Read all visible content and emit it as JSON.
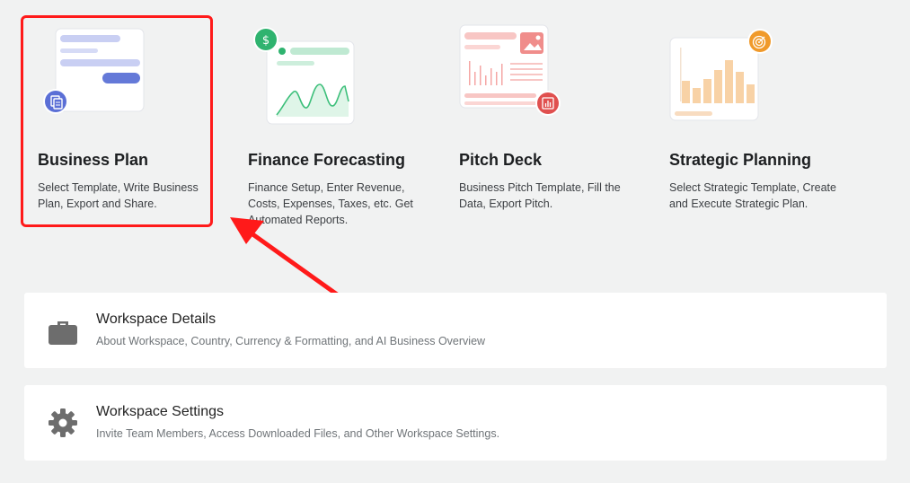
{
  "cards": [
    {
      "title": "Business Plan",
      "desc": "Select Template, Write Business Plan, Export and Share.",
      "icon": "document-icon",
      "badge_color": "#5b6fd6"
    },
    {
      "title": "Finance Forecasting",
      "desc": "Finance Setup, Enter Revenue, Costs, Expenses, Taxes, etc. Get Automated Reports.",
      "icon": "dollar-icon",
      "badge_color": "#2fb36f"
    },
    {
      "title": "Pitch Deck",
      "desc": "Business Pitch Template, Fill the Data, Export Pitch.",
      "icon": "bar-chart-icon",
      "badge_color": "#e0504f"
    },
    {
      "title": "Strategic Planning",
      "desc": "Select Strategic Template, Create and Execute Strategic Plan.",
      "icon": "target-icon",
      "badge_color": "#f09a2b"
    }
  ],
  "rows": [
    {
      "title": "Workspace Details",
      "subtitle": "About Workspace, Country, Currency & Formatting, and AI Business Overview",
      "icon": "briefcase-icon"
    },
    {
      "title": "Workspace Settings",
      "subtitle": "Invite Team Members, Access Downloaded Files, and Other Workspace Settings.",
      "icon": "gear-icon"
    }
  ],
  "annotation": {
    "highlight_color": "#ff1a1a",
    "target": "Business Plan"
  }
}
